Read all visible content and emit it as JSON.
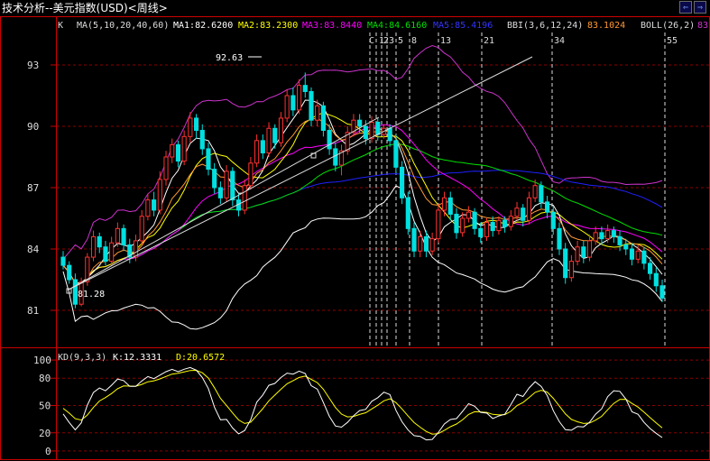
{
  "window": {
    "title": "技术分析--美元指数(USD)<周线>",
    "nav_prev_label": "⇐",
    "nav_next_label": "⇒"
  },
  "main_panel": {
    "k_label": "K",
    "ma_params": "MA(5,10,20,40,60)",
    "ma1": "MA1:82.6200",
    "ma2": "MA2:83.2300",
    "ma3": "MA3:83.8440",
    "ma4": "MA4:84.6160",
    "ma5": "MA5:85.4196",
    "bbi_label": "BBI(3,6,12,24)",
    "bbi_value": "83.1024",
    "boll_label": "BOLL(26,2)",
    "boll_value": "83",
    "high_annotation": "92.63",
    "low_annotation": "81.28"
  },
  "kd_panel": {
    "label": "KD(9,3,3)",
    "k_value": "K:12.3331",
    "d_value": "D:20.6572"
  },
  "colors": {
    "up": "#ff3232",
    "down": "#00e0e0",
    "ma1": "#ffffff",
    "ma2": "#ffff00",
    "ma3": "#ff00ff",
    "ma4": "#00e000",
    "ma5": "#2020ff",
    "bbi": "#ff9933",
    "boll": "#cc33cc",
    "grid": "#8b0000",
    "axis": "#cc0000",
    "fib": "#dddddd"
  },
  "chart_data": [
    {
      "type": "candlestick",
      "y_ticks": [
        81,
        84,
        87,
        90,
        93
      ],
      "ylim": [
        79.5,
        94.5
      ],
      "time_cycle_lines": [
        "C",
        "1",
        "2",
        "3",
        "5",
        "8",
        "13",
        "21",
        "34",
        "55"
      ],
      "series": [
        {
          "name": "MA1",
          "value": 82.62
        },
        {
          "name": "MA2",
          "value": 83.23
        },
        {
          "name": "MA3",
          "value": 83.844
        },
        {
          "name": "MA4",
          "value": 84.616
        },
        {
          "name": "MA5",
          "value": 85.4196
        },
        {
          "name": "BBI",
          "value": 83.1024
        }
      ],
      "candles": [
        [
          83.6,
          83.2,
          83.9,
          83.0
        ],
        [
          83.2,
          82.5,
          83.4,
          82.3
        ],
        [
          82.5,
          81.3,
          82.8,
          81.1
        ],
        [
          81.3,
          82.4,
          82.6,
          81.2
        ],
        [
          82.4,
          83.6,
          83.8,
          82.2
        ],
        [
          83.6,
          84.6,
          84.9,
          83.4
        ],
        [
          84.6,
          84.1,
          84.8,
          83.8
        ],
        [
          84.1,
          83.4,
          84.4,
          83.2
        ],
        [
          83.4,
          84.3,
          84.6,
          83.2
        ],
        [
          84.3,
          85.0,
          85.3,
          84.1
        ],
        [
          85.0,
          84.2,
          85.2,
          83.9
        ],
        [
          84.2,
          83.6,
          84.5,
          83.3
        ],
        [
          83.6,
          84.4,
          84.7,
          83.4
        ],
        [
          84.4,
          85.6,
          85.9,
          84.2
        ],
        [
          85.6,
          86.4,
          86.7,
          85.4
        ],
        [
          86.4,
          85.9,
          86.8,
          85.6
        ],
        [
          85.9,
          87.4,
          87.8,
          85.7
        ],
        [
          87.4,
          88.5,
          88.8,
          87.1
        ],
        [
          88.5,
          89.1,
          89.4,
          88.2
        ],
        [
          89.1,
          88.3,
          89.3,
          88.0
        ],
        [
          88.3,
          89.5,
          89.8,
          88.1
        ],
        [
          89.5,
          90.4,
          90.7,
          89.2
        ],
        [
          90.4,
          89.8,
          90.6,
          89.4
        ],
        [
          89.8,
          88.9,
          90.1,
          88.6
        ],
        [
          88.9,
          87.9,
          89.2,
          87.6
        ],
        [
          87.9,
          87.0,
          88.2,
          86.7
        ],
        [
          87.0,
          86.5,
          87.3,
          86.2
        ],
        [
          86.5,
          87.8,
          88.1,
          86.3
        ],
        [
          87.8,
          86.4,
          88.0,
          86.1
        ],
        [
          86.4,
          85.9,
          86.7,
          85.6
        ],
        [
          85.9,
          87.1,
          87.4,
          85.7
        ],
        [
          87.1,
          88.2,
          88.5,
          86.9
        ],
        [
          88.2,
          89.3,
          89.6,
          88.0
        ],
        [
          89.3,
          88.7,
          89.6,
          88.4
        ],
        [
          88.7,
          89.9,
          90.2,
          88.5
        ],
        [
          89.9,
          89.2,
          90.1,
          88.9
        ],
        [
          89.2,
          90.4,
          90.7,
          89.0
        ],
        [
          90.4,
          91.5,
          91.8,
          90.2
        ],
        [
          91.5,
          90.8,
          91.9,
          90.5
        ],
        [
          90.8,
          92.0,
          92.3,
          90.6
        ],
        [
          92.0,
          91.7,
          92.63,
          91.4
        ],
        [
          91.7,
          90.3,
          91.9,
          90.0
        ],
        [
          90.3,
          91.0,
          91.3,
          90.0
        ],
        [
          91.0,
          89.8,
          91.2,
          89.5
        ],
        [
          89.8,
          88.9,
          90.1,
          88.6
        ],
        [
          88.9,
          88.1,
          89.2,
          87.8
        ],
        [
          88.1,
          88.8,
          89.1,
          87.6
        ],
        [
          88.8,
          89.7,
          90.0,
          88.6
        ],
        [
          89.7,
          90.3,
          90.6,
          89.5
        ],
        [
          90.3,
          90.0,
          90.6,
          89.7
        ],
        [
          90.0,
          89.4,
          90.3,
          89.1
        ],
        [
          89.4,
          90.2,
          90.5,
          89.2
        ],
        [
          90.2,
          89.6,
          90.4,
          89.3
        ],
        [
          89.6,
          89.9,
          90.1,
          89.4
        ],
        [
          89.9,
          89.3,
          90.1,
          89.0
        ],
        [
          89.3,
          88.0,
          89.6,
          87.7
        ],
        [
          88.0,
          86.5,
          88.3,
          86.2
        ],
        [
          86.5,
          85.0,
          86.8,
          84.7
        ],
        [
          85.0,
          83.9,
          85.3,
          83.6
        ],
        [
          83.9,
          84.6,
          84.9,
          83.6
        ],
        [
          84.6,
          83.9,
          84.9,
          83.6
        ],
        [
          83.9,
          84.5,
          84.8,
          83.7
        ],
        [
          84.5,
          85.9,
          86.2,
          84.3
        ],
        [
          85.9,
          86.5,
          86.8,
          85.6
        ],
        [
          86.5,
          85.7,
          86.8,
          85.4
        ],
        [
          85.7,
          84.8,
          86.0,
          84.5
        ],
        [
          84.8,
          85.5,
          85.8,
          84.6
        ],
        [
          85.5,
          85.8,
          86.1,
          85.3
        ],
        [
          85.8,
          85.0,
          86.0,
          84.7
        ],
        [
          85.0,
          84.6,
          85.3,
          84.3
        ],
        [
          84.6,
          85.3,
          85.5,
          84.4
        ],
        [
          85.3,
          84.9,
          85.6,
          84.6
        ],
        [
          84.9,
          85.4,
          85.6,
          84.7
        ],
        [
          85.4,
          85.1,
          85.6,
          84.8
        ],
        [
          85.1,
          85.6,
          85.9,
          84.9
        ],
        [
          85.6,
          86.0,
          86.3,
          85.4
        ],
        [
          86.0,
          85.4,
          86.2,
          85.1
        ],
        [
          85.4,
          86.5,
          86.8,
          85.2
        ],
        [
          86.5,
          87.1,
          87.4,
          86.3
        ],
        [
          87.1,
          86.3,
          87.3,
          86.0
        ],
        [
          86.3,
          85.8,
          86.6,
          85.5
        ],
        [
          85.8,
          85.0,
          86.1,
          84.7
        ],
        [
          85.0,
          84.0,
          85.3,
          83.7
        ],
        [
          84.0,
          82.6,
          84.3,
          82.3
        ],
        [
          82.6,
          83.4,
          83.7,
          82.4
        ],
        [
          83.4,
          84.1,
          84.4,
          83.2
        ],
        [
          84.1,
          83.6,
          84.4,
          83.3
        ],
        [
          83.6,
          84.4,
          84.7,
          83.4
        ],
        [
          84.4,
          84.8,
          85.1,
          84.2
        ],
        [
          84.8,
          84.5,
          85.1,
          84.2
        ],
        [
          84.5,
          84.9,
          85.2,
          84.3
        ],
        [
          84.9,
          84.6,
          85.1,
          84.3
        ],
        [
          84.6,
          84.2,
          84.9,
          83.9
        ],
        [
          84.2,
          84.0,
          84.5,
          83.7
        ],
        [
          84.0,
          83.5,
          84.3,
          83.2
        ],
        [
          83.5,
          83.9,
          84.2,
          83.3
        ],
        [
          83.9,
          83.3,
          84.1,
          83.0
        ],
        [
          83.3,
          82.8,
          83.6,
          82.5
        ],
        [
          82.8,
          82.2,
          83.1,
          81.9
        ],
        [
          82.2,
          81.6,
          82.5,
          81.4
        ]
      ]
    },
    {
      "type": "line",
      "y_ticks": [
        0,
        20,
        50,
        80,
        100
      ],
      "ylim": [
        -8,
        108
      ],
      "series": [
        {
          "name": "K",
          "value": 12.3331
        },
        {
          "name": "D",
          "value": 20.6572
        }
      ]
    }
  ]
}
